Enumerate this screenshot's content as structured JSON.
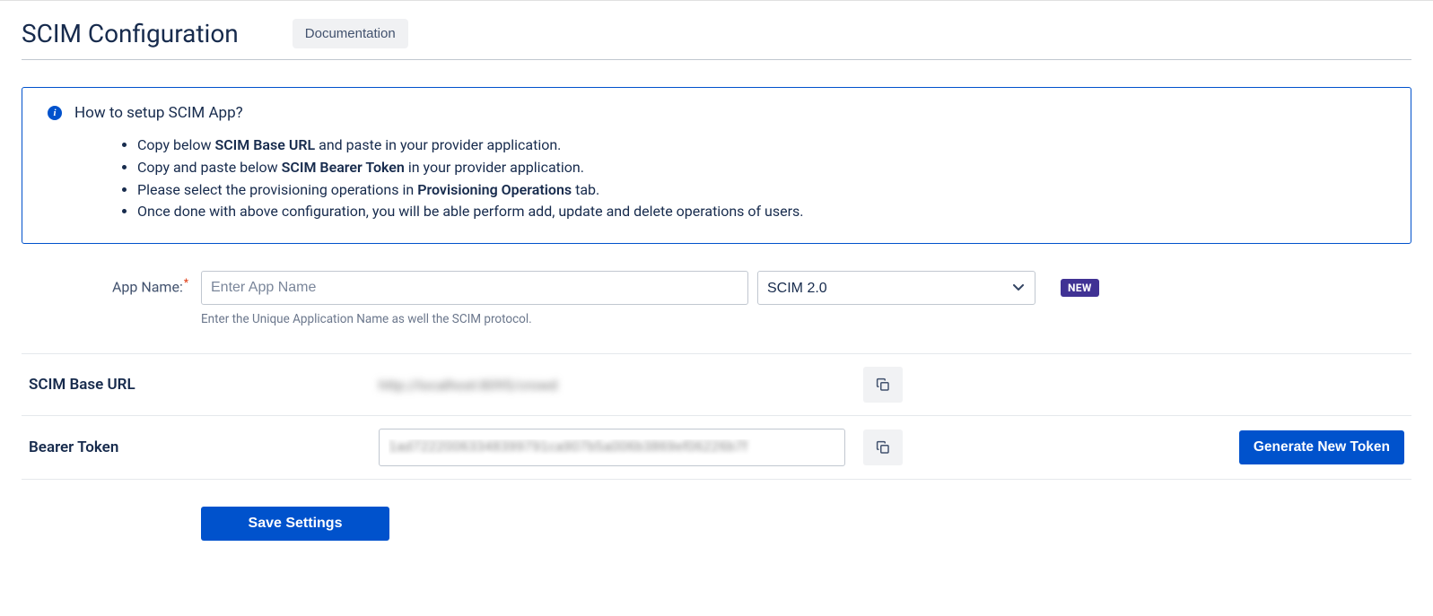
{
  "header": {
    "title": "SCIM Configuration",
    "documentation_label": "Documentation"
  },
  "info": {
    "title": "How to setup SCIM App?",
    "items": [
      {
        "pre": "Copy below ",
        "bold": "SCIM Base URL",
        "post": " and paste in your provider application."
      },
      {
        "pre": "Copy and paste below ",
        "bold": "SCIM Bearer Token",
        "post": " in your provider application."
      },
      {
        "pre": "Please select the provisioning operations in ",
        "bold": "Provisioning Operations",
        "post": " tab."
      },
      {
        "pre": "Once done with above configuration, you will be able perform add, update and delete operations of users.",
        "bold": "",
        "post": ""
      }
    ]
  },
  "form": {
    "app_name_label": "App Name:",
    "app_name_placeholder": "Enter App Name",
    "app_name_value": "",
    "protocol_selected": "SCIM 2.0",
    "new_badge": "NEW",
    "help_text": "Enter the Unique Application Name as well the SCIM protocol."
  },
  "rows": {
    "base_url_label": "SCIM Base URL",
    "base_url_value": "http://localhost:8095/crowd",
    "bearer_label": "Bearer Token",
    "bearer_value": "1ad72220063348399791ca907b5a006b3869ef06226b7f",
    "generate_label": "Generate New Token"
  },
  "actions": {
    "save_label": "Save Settings"
  }
}
